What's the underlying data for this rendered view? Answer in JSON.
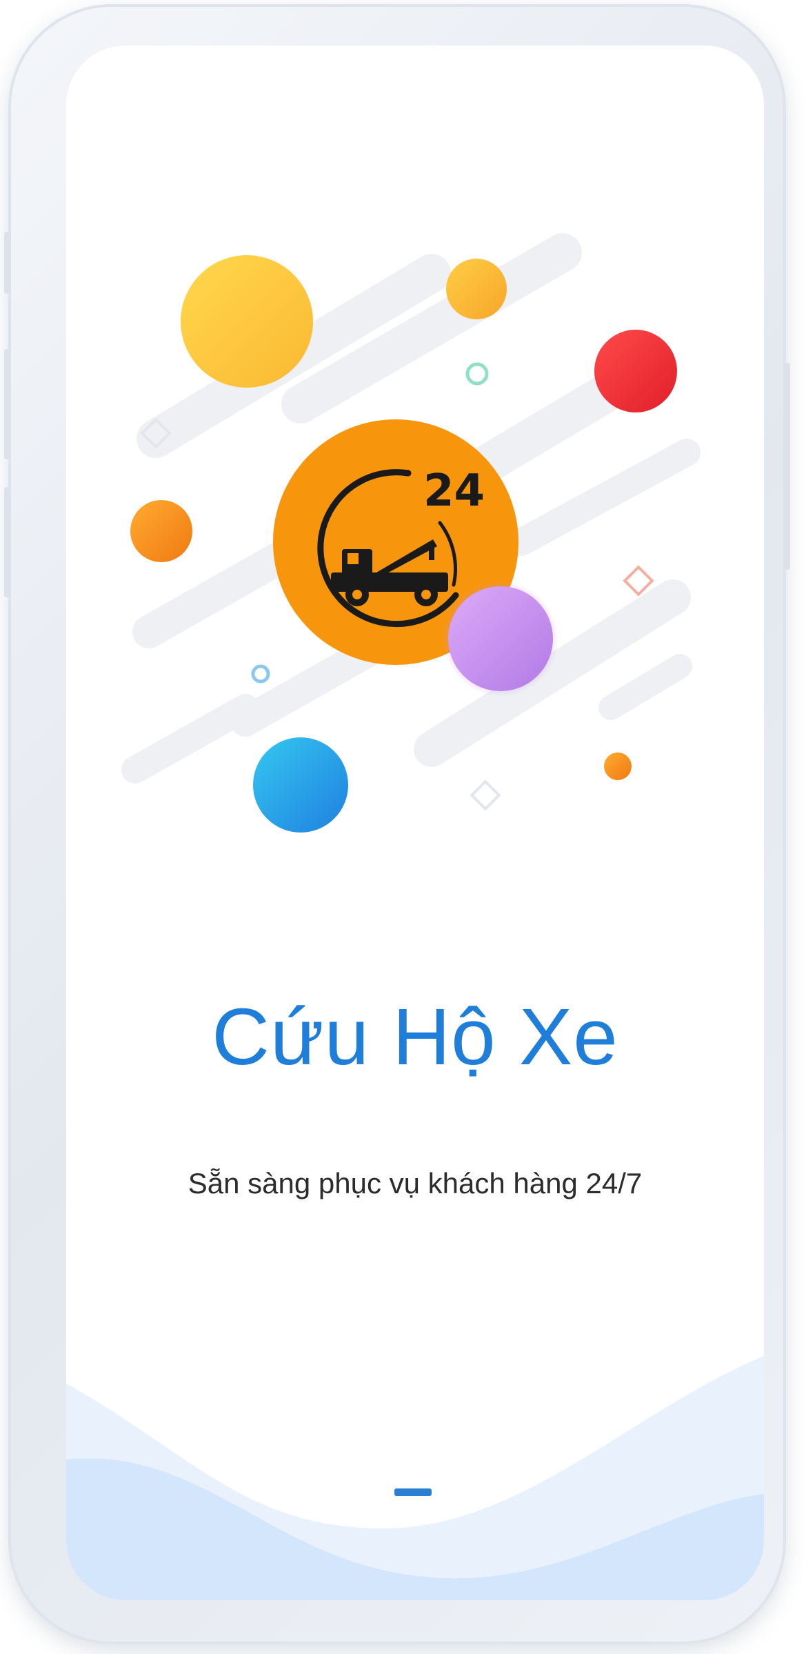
{
  "app": {
    "title": "Cứu Hộ Xe",
    "subtitle": "Sẵn sàng phục vụ khách hàng 24/7",
    "logo": {
      "badge_text": "24",
      "icon": "tow-truck-icon"
    }
  },
  "pager": {
    "current_page": 1
  },
  "colors": {
    "title": "#1f7ed9",
    "logo_bg": "#f7960d",
    "bubble_yellow": "#ffc93d",
    "bubble_red": "#f03030",
    "bubble_purple": "#c88cf0",
    "bubble_blue": "#2aa3ea",
    "bubble_orange": "#f58b1a",
    "wave": "#d4e6fb"
  }
}
